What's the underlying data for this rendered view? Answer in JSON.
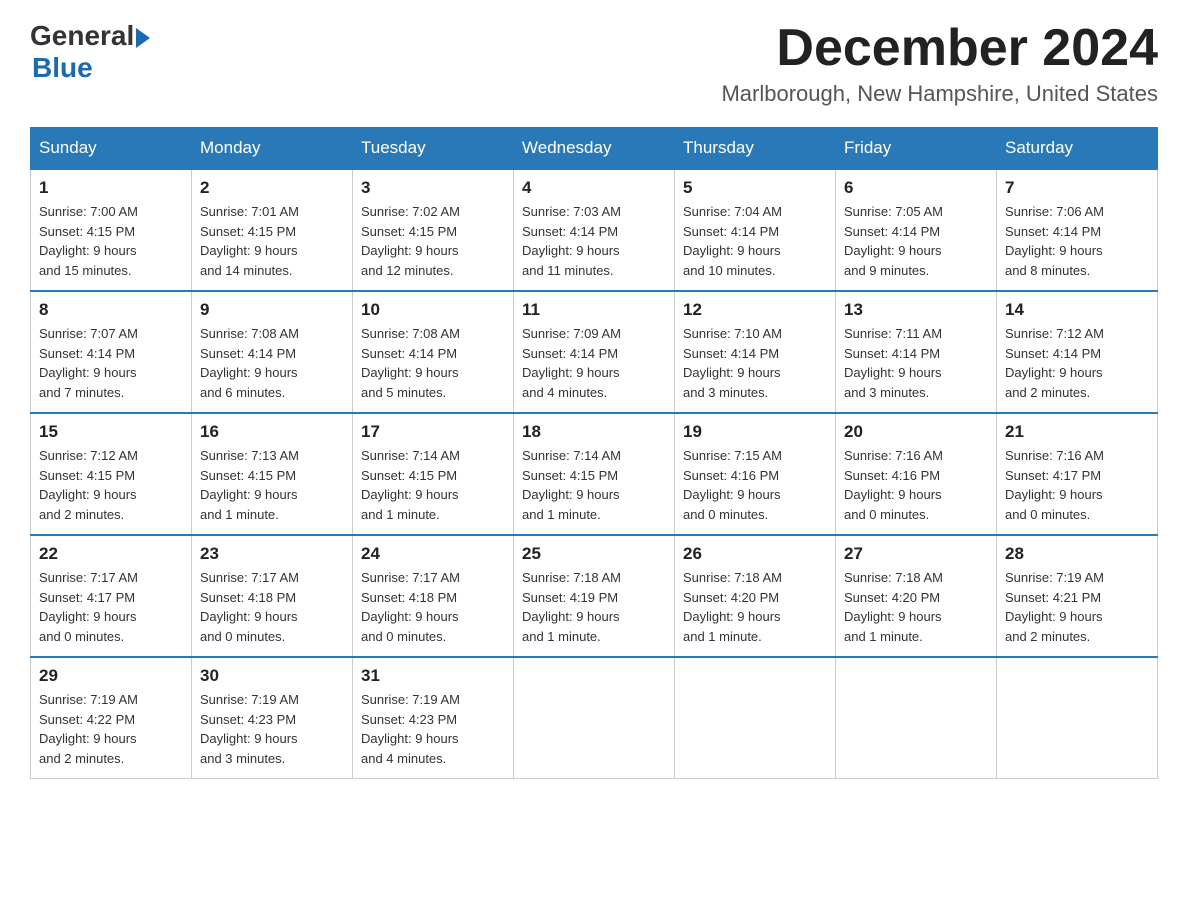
{
  "logo": {
    "text_general": "General",
    "text_blue": "Blue"
  },
  "title": {
    "month": "December 2024",
    "location": "Marlborough, New Hampshire, United States"
  },
  "days_of_week": [
    "Sunday",
    "Monday",
    "Tuesday",
    "Wednesday",
    "Thursday",
    "Friday",
    "Saturday"
  ],
  "weeks": [
    [
      {
        "date": "1",
        "sunrise": "7:00 AM",
        "sunset": "4:15 PM",
        "daylight": "9 hours and 15 minutes."
      },
      {
        "date": "2",
        "sunrise": "7:01 AM",
        "sunset": "4:15 PM",
        "daylight": "9 hours and 14 minutes."
      },
      {
        "date": "3",
        "sunrise": "7:02 AM",
        "sunset": "4:15 PM",
        "daylight": "9 hours and 12 minutes."
      },
      {
        "date": "4",
        "sunrise": "7:03 AM",
        "sunset": "4:14 PM",
        "daylight": "9 hours and 11 minutes."
      },
      {
        "date": "5",
        "sunrise": "7:04 AM",
        "sunset": "4:14 PM",
        "daylight": "9 hours and 10 minutes."
      },
      {
        "date": "6",
        "sunrise": "7:05 AM",
        "sunset": "4:14 PM",
        "daylight": "9 hours and 9 minutes."
      },
      {
        "date": "7",
        "sunrise": "7:06 AM",
        "sunset": "4:14 PM",
        "daylight": "9 hours and 8 minutes."
      }
    ],
    [
      {
        "date": "8",
        "sunrise": "7:07 AM",
        "sunset": "4:14 PM",
        "daylight": "9 hours and 7 minutes."
      },
      {
        "date": "9",
        "sunrise": "7:08 AM",
        "sunset": "4:14 PM",
        "daylight": "9 hours and 6 minutes."
      },
      {
        "date": "10",
        "sunrise": "7:08 AM",
        "sunset": "4:14 PM",
        "daylight": "9 hours and 5 minutes."
      },
      {
        "date": "11",
        "sunrise": "7:09 AM",
        "sunset": "4:14 PM",
        "daylight": "9 hours and 4 minutes."
      },
      {
        "date": "12",
        "sunrise": "7:10 AM",
        "sunset": "4:14 PM",
        "daylight": "9 hours and 3 minutes."
      },
      {
        "date": "13",
        "sunrise": "7:11 AM",
        "sunset": "4:14 PM",
        "daylight": "9 hours and 3 minutes."
      },
      {
        "date": "14",
        "sunrise": "7:12 AM",
        "sunset": "4:14 PM",
        "daylight": "9 hours and 2 minutes."
      }
    ],
    [
      {
        "date": "15",
        "sunrise": "7:12 AM",
        "sunset": "4:15 PM",
        "daylight": "9 hours and 2 minutes."
      },
      {
        "date": "16",
        "sunrise": "7:13 AM",
        "sunset": "4:15 PM",
        "daylight": "9 hours and 1 minute."
      },
      {
        "date": "17",
        "sunrise": "7:14 AM",
        "sunset": "4:15 PM",
        "daylight": "9 hours and 1 minute."
      },
      {
        "date": "18",
        "sunrise": "7:14 AM",
        "sunset": "4:15 PM",
        "daylight": "9 hours and 1 minute."
      },
      {
        "date": "19",
        "sunrise": "7:15 AM",
        "sunset": "4:16 PM",
        "daylight": "9 hours and 0 minutes."
      },
      {
        "date": "20",
        "sunrise": "7:16 AM",
        "sunset": "4:16 PM",
        "daylight": "9 hours and 0 minutes."
      },
      {
        "date": "21",
        "sunrise": "7:16 AM",
        "sunset": "4:17 PM",
        "daylight": "9 hours and 0 minutes."
      }
    ],
    [
      {
        "date": "22",
        "sunrise": "7:17 AM",
        "sunset": "4:17 PM",
        "daylight": "9 hours and 0 minutes."
      },
      {
        "date": "23",
        "sunrise": "7:17 AM",
        "sunset": "4:18 PM",
        "daylight": "9 hours and 0 minutes."
      },
      {
        "date": "24",
        "sunrise": "7:17 AM",
        "sunset": "4:18 PM",
        "daylight": "9 hours and 0 minutes."
      },
      {
        "date": "25",
        "sunrise": "7:18 AM",
        "sunset": "4:19 PM",
        "daylight": "9 hours and 1 minute."
      },
      {
        "date": "26",
        "sunrise": "7:18 AM",
        "sunset": "4:20 PM",
        "daylight": "9 hours and 1 minute."
      },
      {
        "date": "27",
        "sunrise": "7:18 AM",
        "sunset": "4:20 PM",
        "daylight": "9 hours and 1 minute."
      },
      {
        "date": "28",
        "sunrise": "7:19 AM",
        "sunset": "4:21 PM",
        "daylight": "9 hours and 2 minutes."
      }
    ],
    [
      {
        "date": "29",
        "sunrise": "7:19 AM",
        "sunset": "4:22 PM",
        "daylight": "9 hours and 2 minutes."
      },
      {
        "date": "30",
        "sunrise": "7:19 AM",
        "sunset": "4:23 PM",
        "daylight": "9 hours and 3 minutes."
      },
      {
        "date": "31",
        "sunrise": "7:19 AM",
        "sunset": "4:23 PM",
        "daylight": "9 hours and 4 minutes."
      },
      null,
      null,
      null,
      null
    ]
  ],
  "labels": {
    "sunrise": "Sunrise:",
    "sunset": "Sunset:",
    "daylight": "Daylight:"
  }
}
